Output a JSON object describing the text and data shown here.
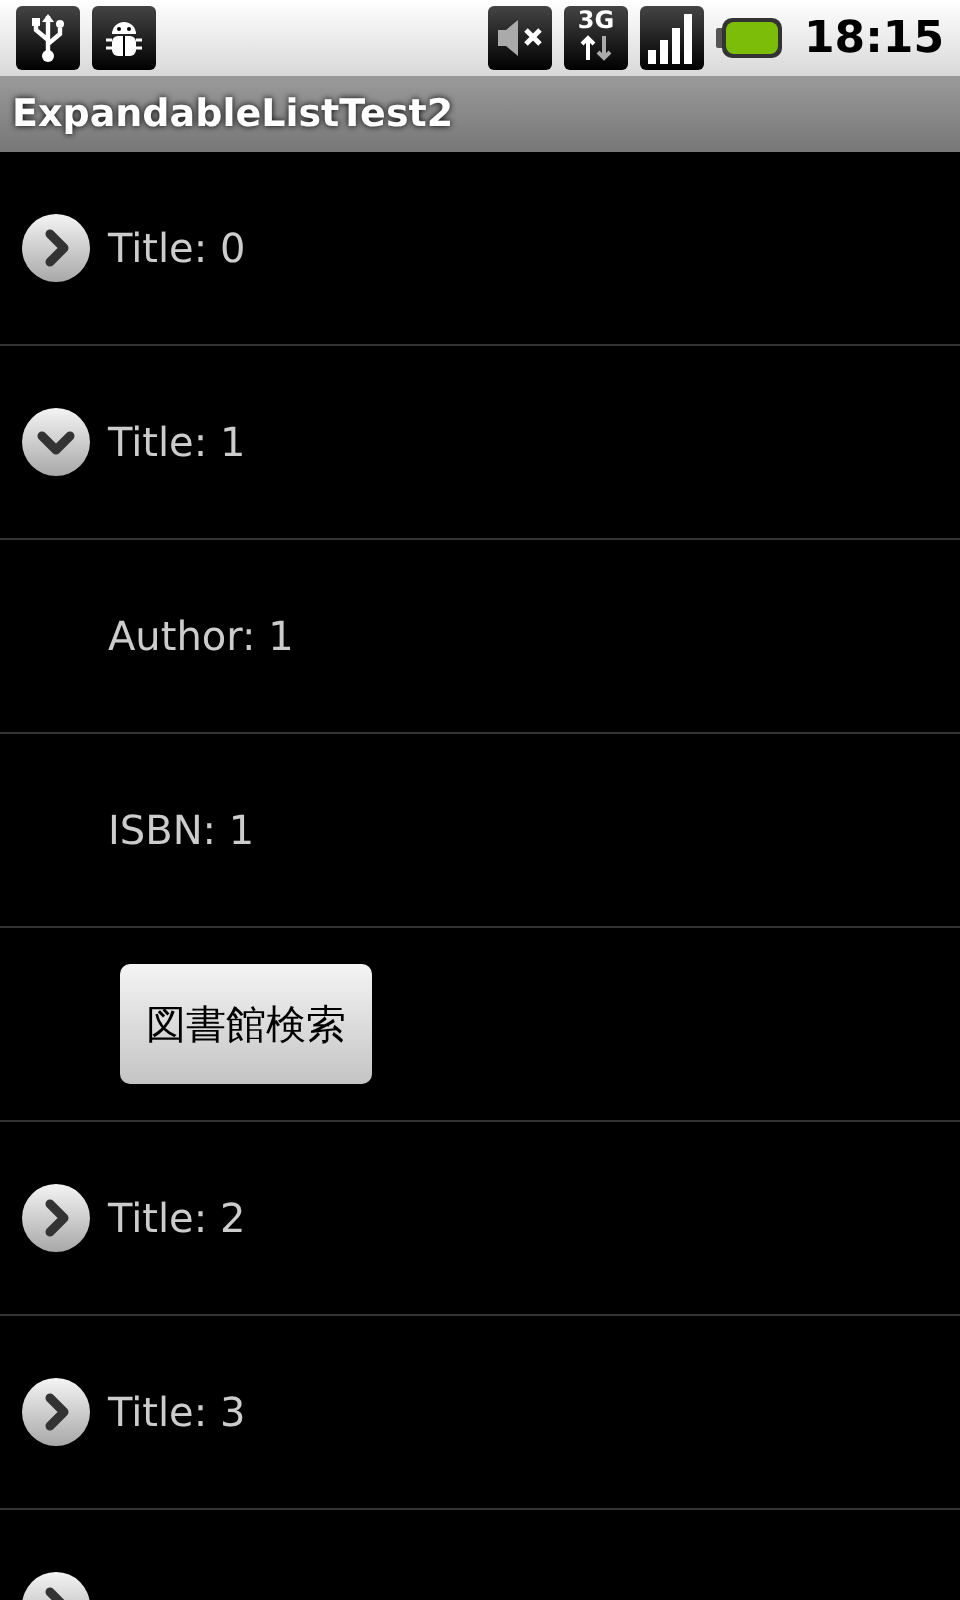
{
  "status_bar": {
    "network_type": "3G",
    "time": "18:15"
  },
  "app_bar": {
    "title": "ExpandableListTest2"
  },
  "groups": [
    {
      "title": "Title: 0",
      "expanded": false
    },
    {
      "title": "Title: 1",
      "expanded": true,
      "children": [
        {
          "kind": "text",
          "text": "Author: 1"
        },
        {
          "kind": "text",
          "text": "ISBN: 1"
        },
        {
          "kind": "button",
          "text": "図書館検索"
        }
      ]
    },
    {
      "title": "Title: 2",
      "expanded": false
    },
    {
      "title": "Title: 3",
      "expanded": false
    },
    {
      "expanded": false
    }
  ]
}
